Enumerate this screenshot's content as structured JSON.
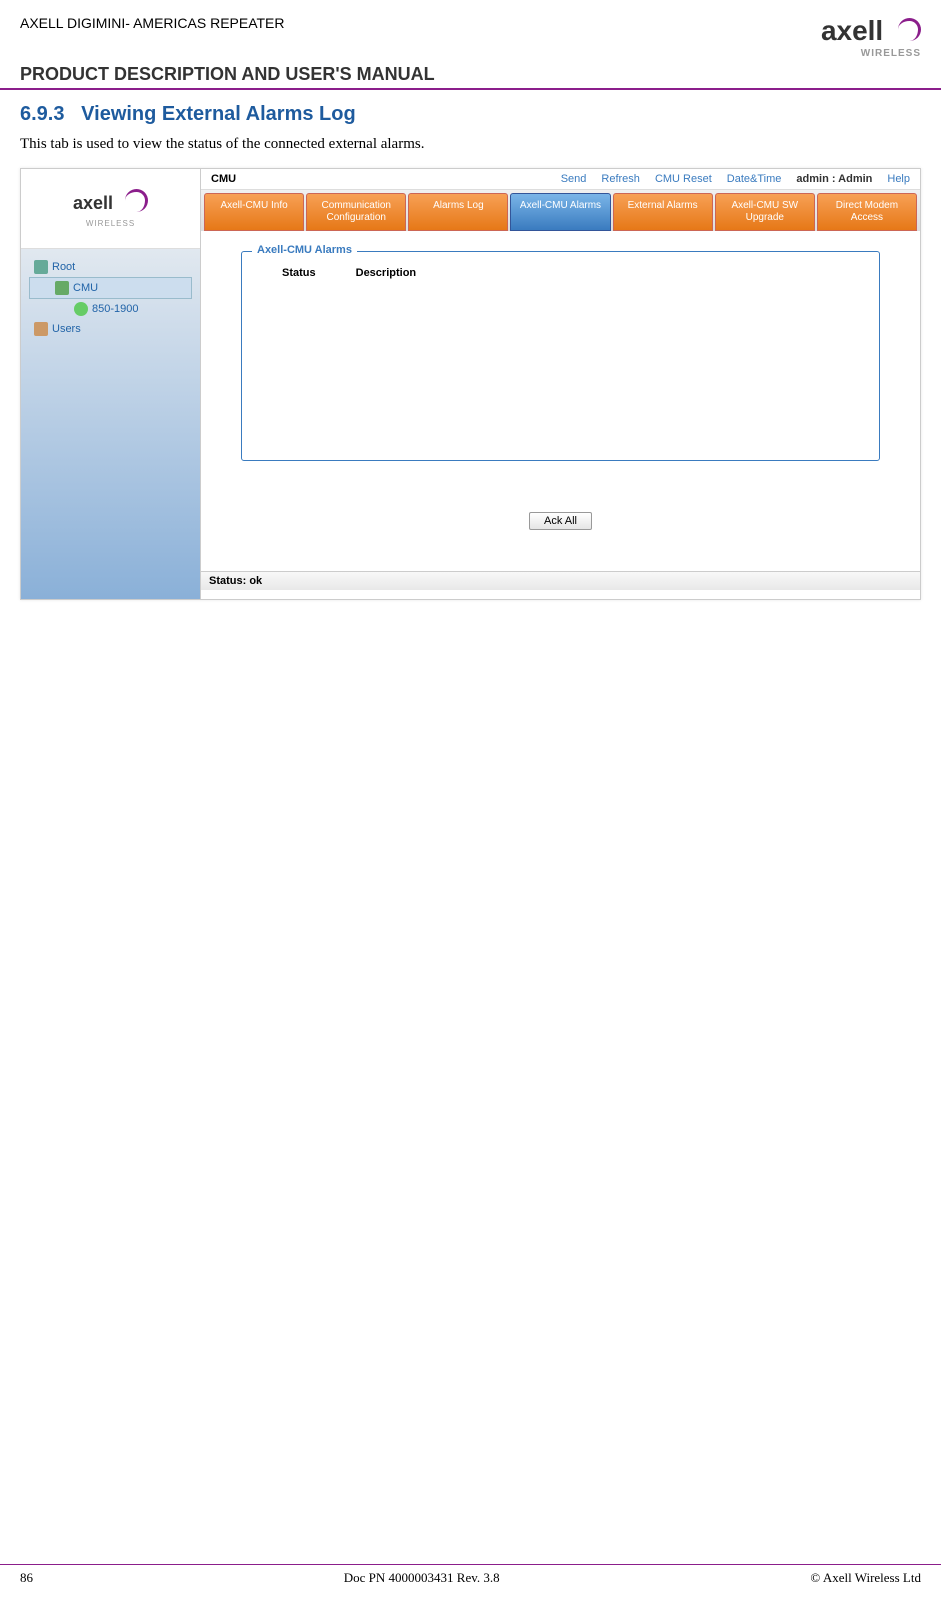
{
  "header": {
    "product_line": "AXELL DIGIMINI- AMERICAS REPEATER",
    "subtitle": "PRODUCT DESCRIPTION AND USER'S MANUAL",
    "brand": "axell",
    "brand_sub": "WIRELESS"
  },
  "section": {
    "number": "6.9.3",
    "title": "Viewing External Alarms Log",
    "description": "This tab is used to view the status of the connected external alarms."
  },
  "screenshot": {
    "sidebar": {
      "logo": "axell",
      "logo_sub": "WIRELESS",
      "tree": {
        "root": "Root",
        "cmu": "CMU",
        "band": "850-1900",
        "users": "Users"
      }
    },
    "topbar": {
      "cmu": "CMU",
      "send": "Send",
      "refresh": "Refresh",
      "cmu_reset": "CMU Reset",
      "datetime": "Date&Time",
      "admin": "admin : Admin",
      "help": "Help"
    },
    "tabs": [
      "Axell-CMU Info",
      "Communication Configuration",
      "Alarms Log",
      "Axell-CMU Alarms",
      "External Alarms",
      "Axell-CMU SW Upgrade",
      "Direct Modem Access"
    ],
    "panel": {
      "legend": "Axell-CMU Alarms",
      "col_status": "Status",
      "col_description": "Description"
    },
    "ack_button": "Ack All",
    "status_bar": "Status: ok"
  },
  "footer": {
    "page": "86",
    "doc": "Doc PN 4000003431 Rev. 3.8",
    "copyright": "© Axell Wireless Ltd"
  }
}
